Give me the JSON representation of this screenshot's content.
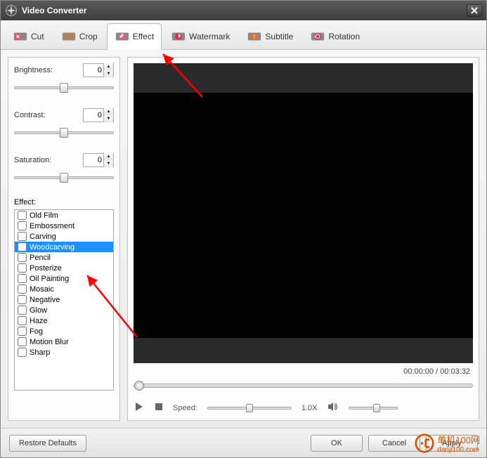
{
  "window": {
    "title": "Video Converter"
  },
  "tabs": [
    {
      "label": "Cut"
    },
    {
      "label": "Crop"
    },
    {
      "label": "Effect"
    },
    {
      "label": "Watermark"
    },
    {
      "label": "Subtitle"
    },
    {
      "label": "Rotation"
    }
  ],
  "active_tab": 2,
  "sliders": {
    "brightness": {
      "label": "Brightness:",
      "value": "0"
    },
    "contrast": {
      "label": "Contrast:",
      "value": "0"
    },
    "saturation": {
      "label": "Saturation:",
      "value": "0"
    }
  },
  "effect": {
    "label": "Effect:",
    "items": [
      "Old Film",
      "Embossment",
      "Carving",
      "Woodcarving",
      "Pencil",
      "Posterize",
      "Oil Painting",
      "Mosaic",
      "Negative",
      "Glow",
      "Haze",
      "Fog",
      "Motion Blur",
      "Sharp"
    ],
    "selected_index": 3
  },
  "player": {
    "current_time": "00:00:00",
    "duration": "00:03:32",
    "speed_label": "Speed:",
    "speed_value": "1.0X"
  },
  "buttons": {
    "restore": "Restore Defaults",
    "ok": "OK",
    "cancel": "Cancel",
    "apply": "Apply"
  },
  "watermark": {
    "line1": "单机100网",
    "line2": "danji100.com"
  },
  "tab_colors": [
    "#ff4d4f",
    "#ff7a00",
    "#ff4d8c",
    "#ff1a4d",
    "#ff6a1a",
    "#ff1a4d"
  ]
}
